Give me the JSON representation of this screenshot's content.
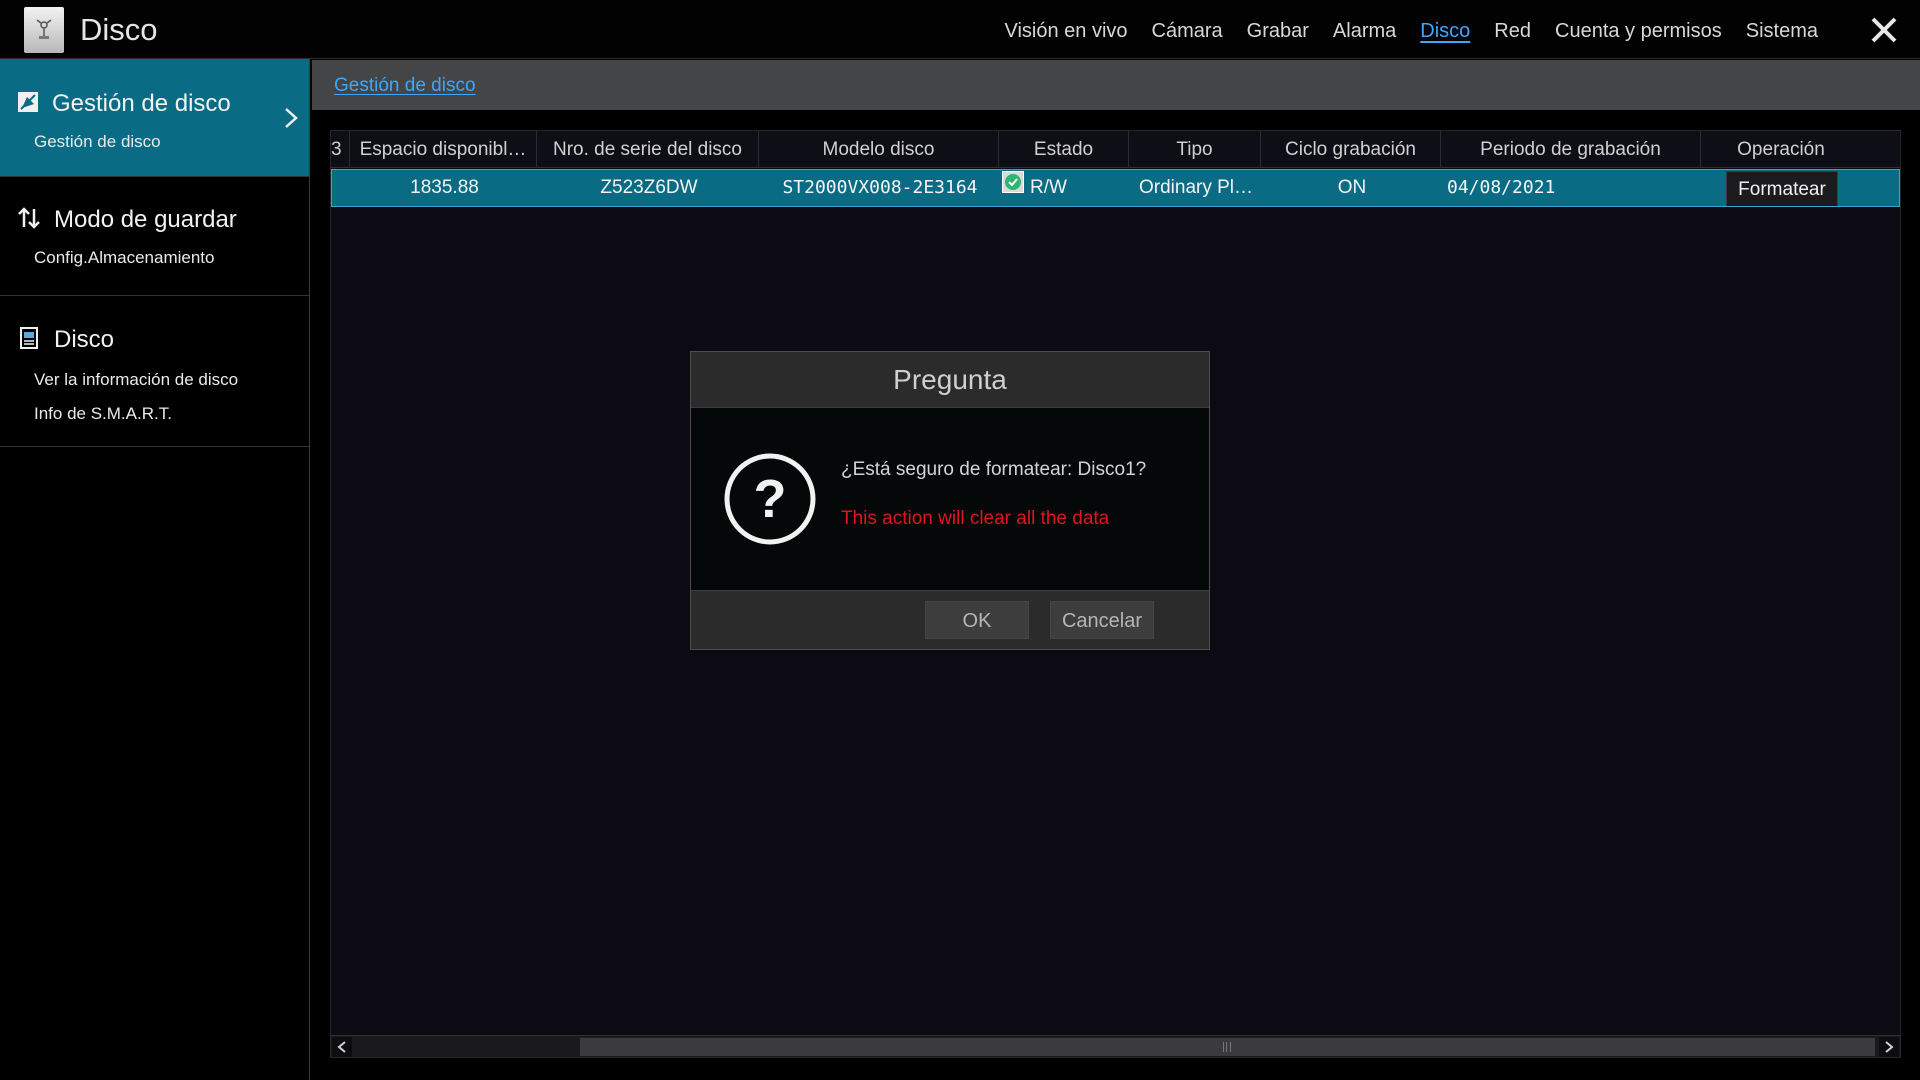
{
  "app": {
    "title": "Disco",
    "icon": "disk-app-icon"
  },
  "topnav": {
    "items": [
      {
        "label": "Visión en vivo",
        "active": false
      },
      {
        "label": "Cámara",
        "active": false
      },
      {
        "label": "Grabar",
        "active": false
      },
      {
        "label": "Alarma",
        "active": false
      },
      {
        "label": "Disco",
        "active": true
      },
      {
        "label": "Red",
        "active": false
      },
      {
        "label": "Cuenta y permisos",
        "active": false
      },
      {
        "label": "Sistema",
        "active": false
      }
    ],
    "close_icon": "close-icon"
  },
  "sidebar": {
    "groups": [
      {
        "title": "Gestión de disco",
        "icon": "disk-manage-icon",
        "active": true,
        "subs": [
          "Gestión de disco"
        ]
      },
      {
        "title": "Modo de guardar",
        "icon": "up-down-arrows-icon",
        "active": false,
        "subs": [
          "Config.Almacenamiento"
        ]
      },
      {
        "title": "Disco",
        "icon": "disk-info-icon",
        "active": false,
        "subs": [
          "Ver la información de disco",
          "Info de S.M.A.R.T."
        ]
      }
    ]
  },
  "breadcrumb": {
    "label": "Gestión de disco"
  },
  "table": {
    "columns": [
      "3",
      "Espacio disponibl…",
      "Nro. de serie del disco",
      "Modelo disco",
      "Estado",
      "Tipo",
      "Ciclo grabación",
      "Periodo de grabación",
      "Operación"
    ],
    "rows": [
      {
        "partial": "",
        "free_space": "1835.88",
        "serial": "Z523Z6DW",
        "model": "ST2000VX008-2E3164",
        "status": "R/W",
        "type": "Ordinary Pl…",
        "cycle": "ON",
        "period": "04/08/2021",
        "operation": "Formatear"
      }
    ]
  },
  "dialog": {
    "title": "Pregunta",
    "message": "¿Está seguro de formatear: Disco1?",
    "warning": "This action will clear all the data",
    "ok_label": "OK",
    "cancel_label": "Cancelar"
  },
  "colors": {
    "accent": "#0a6c84",
    "link": "#3da7ff",
    "warning": "#e0141c"
  }
}
